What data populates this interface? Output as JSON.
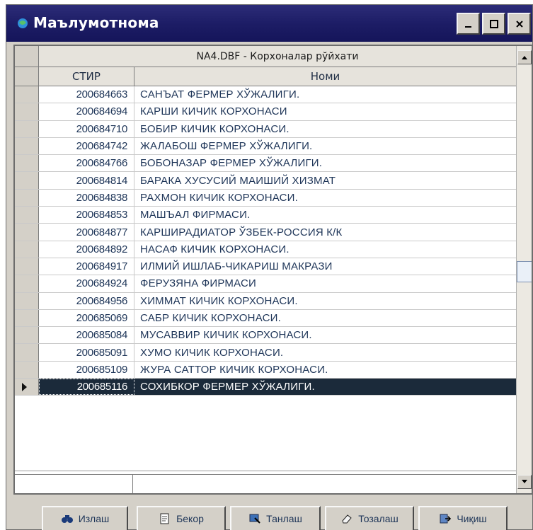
{
  "window": {
    "title": "Маълумотнома"
  },
  "grid": {
    "caption": "NA4.DBF - Корхоналар рўйхати",
    "columns": {
      "stir": "СТИР",
      "nomi": "Номи"
    },
    "rows": [
      {
        "stir": "200684663",
        "nomi": "САНЪАТ ФЕРМЕР ХЎЖАЛИГИ."
      },
      {
        "stir": "200684694",
        "nomi": "КАРШИ КИЧИК КОРХОНАСИ"
      },
      {
        "stir": "200684710",
        "nomi": "БОБИР КИЧИК КОРХОНАСИ."
      },
      {
        "stir": "200684742",
        "nomi": "ЖАЛАБОШ ФЕРМЕР ХЎЖАЛИГИ."
      },
      {
        "stir": "200684766",
        "nomi": "БОБОНАЗАР ФЕРМЕР ХЎЖАЛИГИ."
      },
      {
        "stir": "200684814",
        "nomi": "БАРАКА ХУСУСИЙ МАИШИЙ ХИЗМАТ"
      },
      {
        "stir": "200684838",
        "nomi": "РАХМОН КИЧИК КОРХОНАСИ."
      },
      {
        "stir": "200684853",
        "nomi": "МАШЪАЛ ФИРМАСИ."
      },
      {
        "stir": "200684877",
        "nomi": "КАРШИРАДИАТОР ЎЗБЕК-РОССИЯ К/К"
      },
      {
        "stir": "200684892",
        "nomi": "НАСАФ КИЧИК КОРХОНАСИ."
      },
      {
        "stir": "200684917",
        "nomi": "ИЛМИЙ ИШЛАБ-ЧИКАРИШ МАКРАЗИ"
      },
      {
        "stir": "200684924",
        "nomi": "ФЕРУЗЯНА ФИРМАСИ"
      },
      {
        "stir": "200684956",
        "nomi": "ХИММАТ КИЧИК КОРХОНАСИ."
      },
      {
        "stir": "200685069",
        "nomi": "САБР КИЧИК КОРХОНАСИ."
      },
      {
        "stir": "200685084",
        "nomi": "МУСАВВИР КИЧИК КОРХОНАСИ."
      },
      {
        "stir": "200685091",
        "nomi": "ХУМО КИЧИК КОРХОНАСИ."
      },
      {
        "stir": "200685109",
        "nomi": "ЖУРА САТТОР КИЧИК КОРХОНАСИ."
      },
      {
        "stir": "200685116",
        "nomi": "СОХИБКОР ФЕРМЕР ХЎЖАЛИГИ.",
        "selected": true
      }
    ]
  },
  "buttons": [
    {
      "label": "Излаш",
      "icon": "binoculars-icon"
    },
    {
      "label": "Бекор",
      "icon": "document-icon"
    },
    {
      "label": "Танлаш",
      "icon": "select-icon"
    },
    {
      "label": "Тозалаш",
      "icon": "eraser-icon"
    },
    {
      "label": "Чиқиш",
      "icon": "exit-icon"
    }
  ],
  "colors": {
    "titlebar": "#1d1d66",
    "selected_row": "#1b2a3a",
    "text": "#1e3558",
    "face": "#d4d0c8"
  }
}
